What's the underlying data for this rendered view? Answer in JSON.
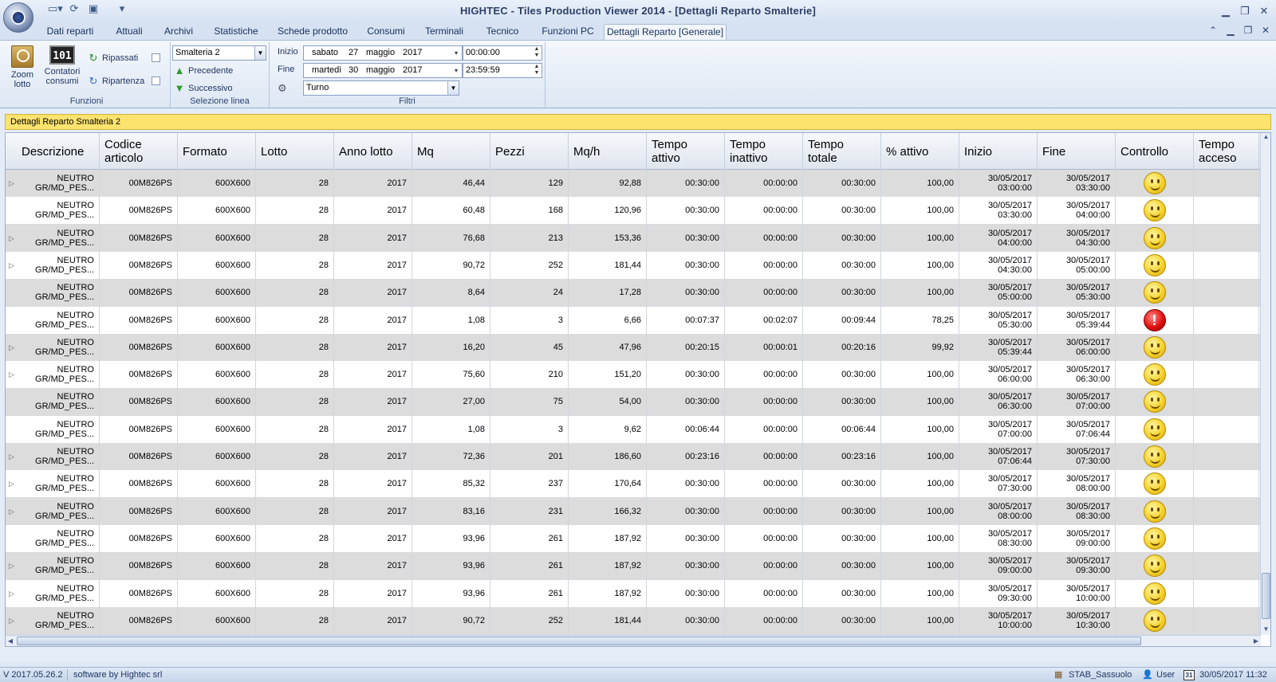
{
  "app": {
    "title": "HIGHTEC - Tiles Production Viewer 2014 - [Dettagli Reparto Smalterie]"
  },
  "icons": {
    "qat": [
      "new-document-icon",
      "refresh-icon",
      "save-icon",
      "customize-icon"
    ],
    "window": [
      "minimize-icon",
      "restore-icon",
      "close-icon"
    ]
  },
  "tabs": [
    {
      "label": "Dati reparti"
    },
    {
      "label": "Attuali"
    },
    {
      "label": "Archivi"
    },
    {
      "label": "Statistiche"
    },
    {
      "label": "Schede prodotto"
    },
    {
      "label": "Consumi"
    },
    {
      "label": "Terminali"
    },
    {
      "label": "Tecnico"
    },
    {
      "label": "Funzioni PC"
    },
    {
      "label": "Dettagli Reparto [Generale]"
    }
  ],
  "ribbon": {
    "funzioni": {
      "zoom_label_1": "Zoom",
      "zoom_label_2": "lotto",
      "contatori_label_1": "Contatori",
      "contatori_label_2": "consumi",
      "counter_display": "101",
      "ripassati": "Ripassati",
      "ripartenza": "Ripartenza",
      "group_label": "Funzioni"
    },
    "selezione": {
      "line_value": "Smalteria 2",
      "precedente": "Precedente",
      "successivo": "Successivo",
      "group_label": "Selezione linea"
    },
    "filtri": {
      "inizio_label": "Inizio",
      "inizio_day": "sabato",
      "inizio_num": "27",
      "inizio_month": "maggio",
      "inizio_year": "2017",
      "inizio_time": "00:00:00",
      "fine_label": "Fine",
      "fine_day": "martedì",
      "fine_num": "30",
      "fine_month": "maggio",
      "fine_year": "2017",
      "fine_time": "23:59:59",
      "turno_value": "Turno",
      "group_label": "Filtri"
    }
  },
  "section": {
    "title": "Dettagli Reparto Smalteria 2"
  },
  "table": {
    "headers": [
      "Descrizione",
      "Codice\narticolo",
      "Formato",
      "Lotto",
      "Anno lotto",
      "Mq",
      "Pezzi",
      "Mq/h",
      "Tempo\nattivo",
      "Tempo\ninattivo",
      "Tempo\ntotale",
      "% attivo",
      "Inizio",
      "Fine",
      "Controllo",
      "Tempo\nacceso"
    ],
    "rows": [
      {
        "desc1": "NEUTRO",
        "desc2": "GR/MD_PES",
        "desc3": "...",
        "codice": "00M826PS",
        "formato": "600X600",
        "lotto": "28",
        "anno": "2017",
        "mq": "46,44",
        "pezzi": "129",
        "mqh": "92,88",
        "attivo": "00:30:00",
        "inattivo": "00:00:00",
        "totale": "00:30:00",
        "perc": "100,00",
        "inizio_d": "30/05/2017",
        "inizio_t": "03:00:00",
        "fine_d": "30/05/2017",
        "fine_t": "03:30:00",
        "controllo": "ok",
        "expander": true
      },
      {
        "desc1": "NEUTRO",
        "desc2": "GR/MD_PES",
        "desc3": "...",
        "codice": "00M826PS",
        "formato": "600X600",
        "lotto": "28",
        "anno": "2017",
        "mq": "60,48",
        "pezzi": "168",
        "mqh": "120,96",
        "attivo": "00:30:00",
        "inattivo": "00:00:00",
        "totale": "00:30:00",
        "perc": "100,00",
        "inizio_d": "30/05/2017",
        "inizio_t": "03:30:00",
        "fine_d": "30/05/2017",
        "fine_t": "04:00:00",
        "controllo": "ok",
        "expander": false
      },
      {
        "desc1": "NEUTRO",
        "desc2": "GR/MD_PES",
        "desc3": "...",
        "codice": "00M826PS",
        "formato": "600X600",
        "lotto": "28",
        "anno": "2017",
        "mq": "76,68",
        "pezzi": "213",
        "mqh": "153,36",
        "attivo": "00:30:00",
        "inattivo": "00:00:00",
        "totale": "00:30:00",
        "perc": "100,00",
        "inizio_d": "30/05/2017",
        "inizio_t": "04:00:00",
        "fine_d": "30/05/2017",
        "fine_t": "04:30:00",
        "controllo": "ok",
        "expander": true
      },
      {
        "desc1": "NEUTRO",
        "desc2": "GR/MD_PES",
        "desc3": "...",
        "codice": "00M826PS",
        "formato": "600X600",
        "lotto": "28",
        "anno": "2017",
        "mq": "90,72",
        "pezzi": "252",
        "mqh": "181,44",
        "attivo": "00:30:00",
        "inattivo": "00:00:00",
        "totale": "00:30:00",
        "perc": "100,00",
        "inizio_d": "30/05/2017",
        "inizio_t": "04:30:00",
        "fine_d": "30/05/2017",
        "fine_t": "05:00:00",
        "controllo": "ok",
        "expander": true
      },
      {
        "desc1": "NEUTRO",
        "desc2": "GR/MD_PES",
        "desc3": "...",
        "codice": "00M826PS",
        "formato": "600X600",
        "lotto": "28",
        "anno": "2017",
        "mq": "8,64",
        "pezzi": "24",
        "mqh": "17,28",
        "attivo": "00:30:00",
        "inattivo": "00:00:00",
        "totale": "00:30:00",
        "perc": "100,00",
        "inizio_d": "30/05/2017",
        "inizio_t": "05:00:00",
        "fine_d": "30/05/2017",
        "fine_t": "05:30:00",
        "controllo": "ok",
        "expander": false
      },
      {
        "desc1": "NEUTRO",
        "desc2": "GR/MD_PES",
        "desc3": "...",
        "codice": "00M826PS",
        "formato": "600X600",
        "lotto": "28",
        "anno": "2017",
        "mq": "1,08",
        "pezzi": "3",
        "mqh": "6,66",
        "attivo": "00:07:37",
        "inattivo": "00:02:07",
        "totale": "00:09:44",
        "perc": "78,25",
        "inizio_d": "30/05/2017",
        "inizio_t": "05:30:00",
        "fine_d": "30/05/2017",
        "fine_t": "05:39:44",
        "controllo": "alert",
        "expander": false
      },
      {
        "desc1": "NEUTRO",
        "desc2": "GR/MD_PES",
        "desc3": "...",
        "codice": "00M826PS",
        "formato": "600X600",
        "lotto": "28",
        "anno": "2017",
        "mq": "16,20",
        "pezzi": "45",
        "mqh": "47,96",
        "attivo": "00:20:15",
        "inattivo": "00:00:01",
        "totale": "00:20:16",
        "perc": "99,92",
        "inizio_d": "30/05/2017",
        "inizio_t": "05:39:44",
        "fine_d": "30/05/2017",
        "fine_t": "06:00:00",
        "controllo": "ok",
        "expander": true
      },
      {
        "desc1": "NEUTRO",
        "desc2": "GR/MD_PES",
        "desc3": "...",
        "codice": "00M826PS",
        "formato": "600X600",
        "lotto": "28",
        "anno": "2017",
        "mq": "75,60",
        "pezzi": "210",
        "mqh": "151,20",
        "attivo": "00:30:00",
        "inattivo": "00:00:00",
        "totale": "00:30:00",
        "perc": "100,00",
        "inizio_d": "30/05/2017",
        "inizio_t": "06:00:00",
        "fine_d": "30/05/2017",
        "fine_t": "06:30:00",
        "controllo": "ok",
        "expander": true
      },
      {
        "desc1": "NEUTRO",
        "desc2": "GR/MD_PES",
        "desc3": "...",
        "codice": "00M826PS",
        "formato": "600X600",
        "lotto": "28",
        "anno": "2017",
        "mq": "27,00",
        "pezzi": "75",
        "mqh": "54,00",
        "attivo": "00:30:00",
        "inattivo": "00:00:00",
        "totale": "00:30:00",
        "perc": "100,00",
        "inizio_d": "30/05/2017",
        "inizio_t": "06:30:00",
        "fine_d": "30/05/2017",
        "fine_t": "07:00:00",
        "controllo": "ok",
        "expander": false
      },
      {
        "desc1": "NEUTRO",
        "desc2": "GR/MD_PES",
        "desc3": "...",
        "codice": "00M826PS",
        "formato": "600X600",
        "lotto": "28",
        "anno": "2017",
        "mq": "1,08",
        "pezzi": "3",
        "mqh": "9,62",
        "attivo": "00:06:44",
        "inattivo": "00:00:00",
        "totale": "00:06:44",
        "perc": "100,00",
        "inizio_d": "30/05/2017",
        "inizio_t": "07:00:00",
        "fine_d": "30/05/2017",
        "fine_t": "07:06:44",
        "controllo": "ok",
        "expander": false
      },
      {
        "desc1": "NEUTRO",
        "desc2": "GR/MD_PES",
        "desc3": "...",
        "codice": "00M826PS",
        "formato": "600X600",
        "lotto": "28",
        "anno": "2017",
        "mq": "72,36",
        "pezzi": "201",
        "mqh": "186,60",
        "attivo": "00:23:16",
        "inattivo": "00:00:00",
        "totale": "00:23:16",
        "perc": "100,00",
        "inizio_d": "30/05/2017",
        "inizio_t": "07:06:44",
        "fine_d": "30/05/2017",
        "fine_t": "07:30:00",
        "controllo": "ok",
        "expander": true
      },
      {
        "desc1": "NEUTRO",
        "desc2": "GR/MD_PES",
        "desc3": "...",
        "codice": "00M826PS",
        "formato": "600X600",
        "lotto": "28",
        "anno": "2017",
        "mq": "85,32",
        "pezzi": "237",
        "mqh": "170,64",
        "attivo": "00:30:00",
        "inattivo": "00:00:00",
        "totale": "00:30:00",
        "perc": "100,00",
        "inizio_d": "30/05/2017",
        "inizio_t": "07:30:00",
        "fine_d": "30/05/2017",
        "fine_t": "08:00:00",
        "controllo": "ok",
        "expander": true
      },
      {
        "desc1": "NEUTRO",
        "desc2": "GR/MD_PES",
        "desc3": "...",
        "codice": "00M826PS",
        "formato": "600X600",
        "lotto": "28",
        "anno": "2017",
        "mq": "83,16",
        "pezzi": "231",
        "mqh": "166,32",
        "attivo": "00:30:00",
        "inattivo": "00:00:00",
        "totale": "00:30:00",
        "perc": "100,00",
        "inizio_d": "30/05/2017",
        "inizio_t": "08:00:00",
        "fine_d": "30/05/2017",
        "fine_t": "08:30:00",
        "controllo": "ok",
        "expander": true
      },
      {
        "desc1": "NEUTRO",
        "desc2": "GR/MD_PES",
        "desc3": "...",
        "codice": "00M826PS",
        "formato": "600X600",
        "lotto": "28",
        "anno": "2017",
        "mq": "93,96",
        "pezzi": "261",
        "mqh": "187,92",
        "attivo": "00:30:00",
        "inattivo": "00:00:00",
        "totale": "00:30:00",
        "perc": "100,00",
        "inizio_d": "30/05/2017",
        "inizio_t": "08:30:00",
        "fine_d": "30/05/2017",
        "fine_t": "09:00:00",
        "controllo": "ok",
        "expander": false
      },
      {
        "desc1": "NEUTRO",
        "desc2": "GR/MD_PES",
        "desc3": "...",
        "codice": "00M826PS",
        "formato": "600X600",
        "lotto": "28",
        "anno": "2017",
        "mq": "93,96",
        "pezzi": "261",
        "mqh": "187,92",
        "attivo": "00:30:00",
        "inattivo": "00:00:00",
        "totale": "00:30:00",
        "perc": "100,00",
        "inizio_d": "30/05/2017",
        "inizio_t": "09:00:00",
        "fine_d": "30/05/2017",
        "fine_t": "09:30:00",
        "controllo": "ok",
        "expander": true
      },
      {
        "desc1": "NEUTRO",
        "desc2": "GR/MD_PES",
        "desc3": "...",
        "codice": "00M826PS",
        "formato": "600X600",
        "lotto": "28",
        "anno": "2017",
        "mq": "93,96",
        "pezzi": "261",
        "mqh": "187,92",
        "attivo": "00:30:00",
        "inattivo": "00:00:00",
        "totale": "00:30:00",
        "perc": "100,00",
        "inizio_d": "30/05/2017",
        "inizio_t": "09:30:00",
        "fine_d": "30/05/2017",
        "fine_t": "10:00:00",
        "controllo": "ok",
        "expander": true
      },
      {
        "desc1": "NEUTRO",
        "desc2": "GR/MD_PES",
        "desc3": "...",
        "codice": "00M826PS",
        "formato": "600X600",
        "lotto": "28",
        "anno": "2017",
        "mq": "90,72",
        "pezzi": "252",
        "mqh": "181,44",
        "attivo": "00:30:00",
        "inattivo": "00:00:00",
        "totale": "00:30:00",
        "perc": "100,00",
        "inizio_d": "30/05/2017",
        "inizio_t": "10:00:00",
        "fine_d": "30/05/2017",
        "fine_t": "10:30:00",
        "controllo": "ok",
        "expander": true
      }
    ]
  },
  "status": {
    "version": "V 2017.05.26.2",
    "credits": "software by Hightec srl",
    "site": "STAB_Sassuolo",
    "user": "User",
    "calendar_day": "31",
    "datetime": "30/05/2017 11:32"
  },
  "colors": {
    "section_header": "#fbe36e",
    "alt_row": "#dcdcdc",
    "ok_indicator": "#f6d22c",
    "alert_indicator": "#e01010"
  }
}
